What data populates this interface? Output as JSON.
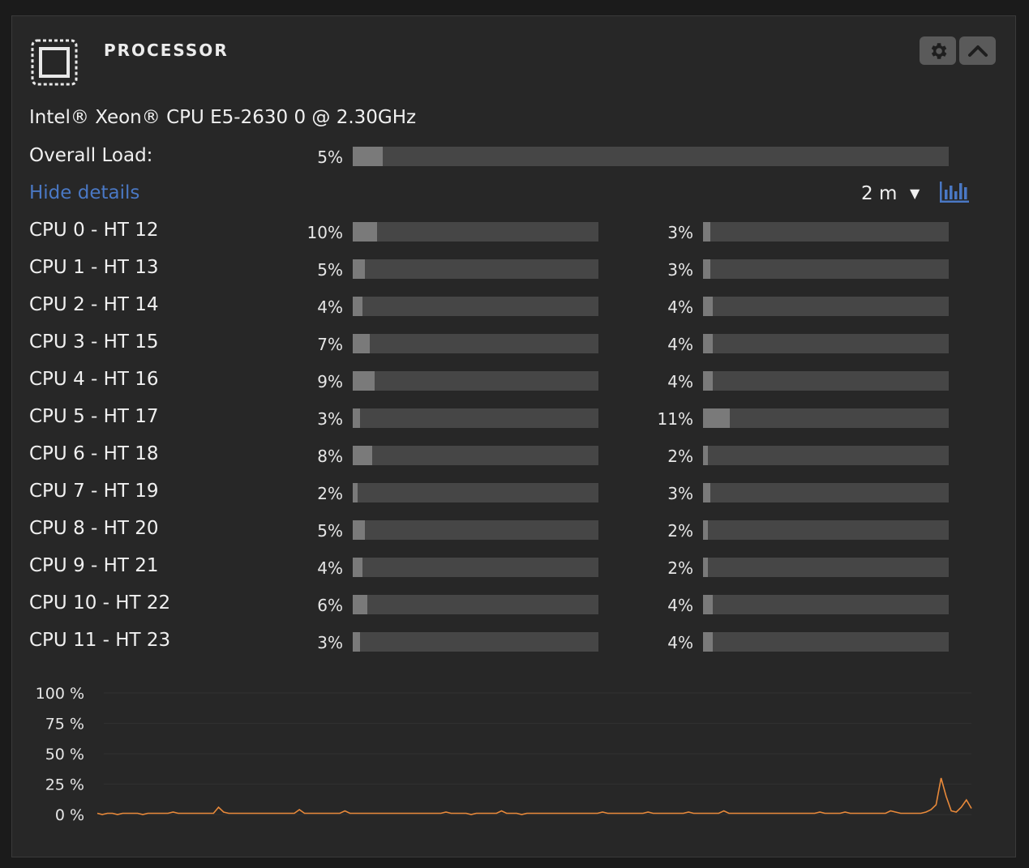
{
  "header": {
    "title": "PROCESSOR",
    "settings_icon": "gear-icon",
    "collapse_icon": "chevron-up-icon"
  },
  "cpu_model": "Intel® Xeon® CPU E5-2630 0 @ 2.30GHz",
  "overall": {
    "label": "Overall Load:",
    "pct_text": "5%",
    "value": 5
  },
  "details": {
    "hide_label": "Hide details",
    "range": "2 m",
    "chart_icon": "bar-chart-icon"
  },
  "cores": [
    {
      "label": "CPU 0 - HT 12",
      "a_text": "10%",
      "a": 10,
      "b_text": "3%",
      "b": 3
    },
    {
      "label": "CPU 1 - HT 13",
      "a_text": "5%",
      "a": 5,
      "b_text": "3%",
      "b": 3
    },
    {
      "label": "CPU 2 - HT 14",
      "a_text": "4%",
      "a": 4,
      "b_text": "4%",
      "b": 4
    },
    {
      "label": "CPU 3 - HT 15",
      "a_text": "7%",
      "a": 7,
      "b_text": "4%",
      "b": 4
    },
    {
      "label": "CPU 4 - HT 16",
      "a_text": "9%",
      "a": 9,
      "b_text": "4%",
      "b": 4
    },
    {
      "label": "CPU 5 - HT 17",
      "a_text": "3%",
      "a": 3,
      "b_text": "11%",
      "b": 11
    },
    {
      "label": "CPU 6 - HT 18",
      "a_text": "8%",
      "a": 8,
      "b_text": "2%",
      "b": 2
    },
    {
      "label": "CPU 7 - HT 19",
      "a_text": "2%",
      "a": 2,
      "b_text": "3%",
      "b": 3
    },
    {
      "label": "CPU 8 - HT 20",
      "a_text": "5%",
      "a": 5,
      "b_text": "2%",
      "b": 2
    },
    {
      "label": "CPU 9 - HT 21",
      "a_text": "4%",
      "a": 4,
      "b_text": "2%",
      "b": 2
    },
    {
      "label": "CPU 10 - HT 22",
      "a_text": "6%",
      "a": 6,
      "b_text": "4%",
      "b": 4
    },
    {
      "label": "CPU 11 - HT 23",
      "a_text": "3%",
      "a": 3,
      "b_text": "4%",
      "b": 4
    }
  ],
  "chart_data": {
    "type": "line",
    "yticks": [
      "100 %",
      "75 %",
      "50 %",
      "25 %",
      "0 %"
    ],
    "ylim": [
      0,
      100
    ],
    "series": [
      {
        "color": "#e8893a",
        "values": [
          1,
          0,
          1,
          1,
          0,
          1,
          1,
          1,
          1,
          0,
          1,
          1,
          1,
          1,
          1,
          2,
          1,
          1,
          1,
          1,
          1,
          1,
          1,
          1,
          6,
          2,
          1,
          1,
          1,
          1,
          1,
          1,
          1,
          1,
          1,
          1,
          1,
          1,
          1,
          1,
          4,
          1,
          1,
          1,
          1,
          1,
          1,
          1,
          1,
          3,
          1,
          1,
          1,
          1,
          1,
          1,
          1,
          1,
          1,
          1,
          1,
          1,
          1,
          1,
          1,
          1,
          1,
          1,
          1,
          2,
          1,
          1,
          1,
          1,
          0,
          1,
          1,
          1,
          1,
          1,
          3,
          1,
          1,
          1,
          0,
          1,
          1,
          1,
          1,
          1,
          1,
          1,
          1,
          1,
          1,
          1,
          1,
          1,
          1,
          1,
          2,
          1,
          1,
          1,
          1,
          1,
          1,
          1,
          1,
          2,
          1,
          1,
          1,
          1,
          1,
          1,
          1,
          2,
          1,
          1,
          1,
          1,
          1,
          1,
          3,
          1,
          1,
          1,
          1,
          1,
          1,
          1,
          1,
          1,
          1,
          1,
          1,
          1,
          1,
          1,
          1,
          1,
          1,
          2,
          1,
          1,
          1,
          1,
          2,
          1,
          1,
          1,
          1,
          1,
          1,
          1,
          1,
          3,
          2,
          1,
          1,
          1,
          1,
          1,
          2,
          4,
          8,
          30,
          15,
          3,
          2,
          6,
          12,
          5
        ]
      }
    ]
  }
}
